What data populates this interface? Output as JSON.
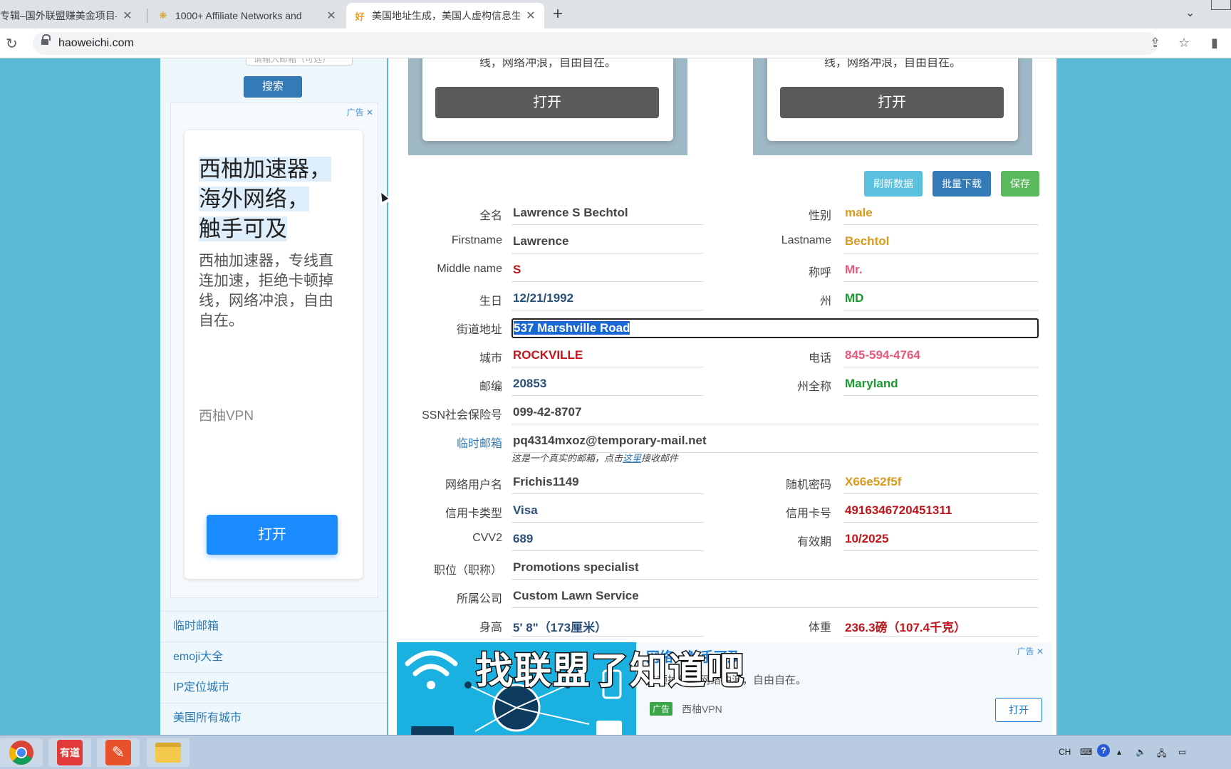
{
  "browser": {
    "tabs": [
      {
        "title": "专辑–国外联盟赚美金项目–",
        "active": false
      },
      {
        "title": "1000+ Affiliate Networks and",
        "active": false
      },
      {
        "title": "美国地址生成，美国人虚构信息生",
        "active": true
      }
    ],
    "url": "haoweichi.com"
  },
  "sidebar": {
    "search_placeholder": "请输入邮箱（可选）",
    "search_button": "搜索",
    "ad_label": "广告",
    "ad_headline_1": "西柚加速器，",
    "ad_headline_2": "海外网络，",
    "ad_headline_3": "触手可及",
    "ad_desc": "西柚加速器，专线直连加速，拒绝卡顿掉线，网络冲浪，自由自在。",
    "ad_brand": "西柚VPN",
    "ad_open": "打开",
    "links": [
      "临时邮箱",
      "emoji大全",
      "IP定位城市",
      "美国所有城市"
    ]
  },
  "top_cards": {
    "text": "线，网络冲浪，自由自在。",
    "button": "打开"
  },
  "actions": {
    "refresh": "刷新数据",
    "batch_download": "批量下载",
    "save": "保存"
  },
  "fields": {
    "fullname": {
      "label": "全名",
      "value": "Lawrence S Bechtol"
    },
    "gender": {
      "label": "性别",
      "value": "male"
    },
    "firstname": {
      "label": "Firstname",
      "value": "Lawrence"
    },
    "lastname": {
      "label": "Lastname",
      "value": "Bechtol"
    },
    "middlename": {
      "label": "Middle name",
      "value": "S"
    },
    "title": {
      "label": "称呼",
      "value": "Mr."
    },
    "birthday": {
      "label": "生日",
      "value": "12/21/1992"
    },
    "state": {
      "label": "州",
      "value": "MD"
    },
    "street": {
      "label": "街道地址",
      "value": "537 Marshville Road"
    },
    "city": {
      "label": "城市",
      "value": "ROCKVILLE"
    },
    "phone": {
      "label": "电话",
      "value": "845-594-4764"
    },
    "zip": {
      "label": "邮编",
      "value": "20853"
    },
    "state_full": {
      "label": "州全称",
      "value": "Maryland"
    },
    "ssn": {
      "label": "SSN社会保险号",
      "value": "099-42-8707"
    },
    "temp_email": {
      "label": "临时邮箱",
      "value": "pq4314mxoz@temporary-mail.net"
    },
    "email_note_pre": "这是一个真实的邮箱，点击",
    "email_note_link": "这里",
    "email_note_post": "接收邮件",
    "username": {
      "label": "网络用户名",
      "value": "Frichis1149"
    },
    "password": {
      "label": "随机密码",
      "value": "X66e52f5f"
    },
    "card_type": {
      "label": "信用卡类型",
      "value": "Visa"
    },
    "card_number": {
      "label": "信用卡号",
      "value": "4916346720451311"
    },
    "cvv": {
      "label": "CVV2",
      "value": "689"
    },
    "expiry": {
      "label": "有效期",
      "value": "10/2025"
    },
    "job": {
      "label": "职位（职称）",
      "value": "Promotions specialist"
    },
    "company": {
      "label": "所属公司",
      "value": "Custom Lawn Service"
    },
    "height": {
      "label": "身高",
      "value": "5' 8\"（173厘米）"
    },
    "weight": {
      "label": "体重",
      "value": "236.3磅（107.4千克）"
    }
  },
  "bottom_ad": {
    "title": "网络，触手可及",
    "desc": "卡顿掉线，网络冲浪，自由自在。",
    "tag": "广告",
    "brand": "西柚VPN",
    "open": "打开",
    "ad_label": "广告"
  },
  "caption": "找联盟了知道吧",
  "taskbar": {
    "apps": [
      "chrome-icon",
      "youdao-icon",
      "app-icon",
      "folder-icon"
    ],
    "youdao_label": "有道",
    "ime": "CH"
  }
}
